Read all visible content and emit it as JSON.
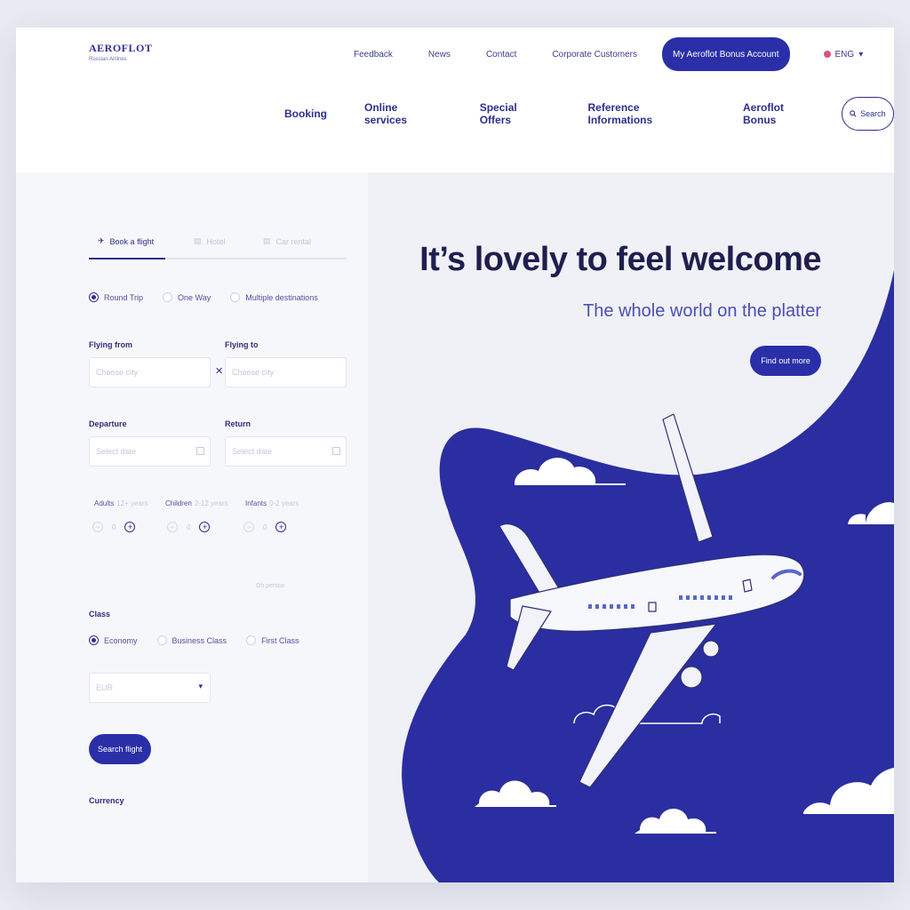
{
  "header": {
    "brand": "AEROFLOT",
    "tagline": "Russian Airlines",
    "top_links": [
      "Feedback",
      "News",
      "Contact",
      "Corporate Customers"
    ],
    "bonus_account": "My Aeroflot Bonus Account",
    "language": "ENG",
    "main_links": [
      "Booking",
      "Online services",
      "Special Offers",
      "Reference Informations",
      "Aeroflot Bonus"
    ],
    "search_label": "Search"
  },
  "booking": {
    "tabs": [
      "Book a flight",
      "Hotel",
      "Car rental"
    ],
    "trip_types": [
      "Round Trip",
      "One Way",
      "Multiple destinations"
    ],
    "from_label": "Flying from",
    "from_placeholder": "Choose city",
    "to_label": "Flying to",
    "to_placeholder": "Choose city",
    "departure_label": "Departure",
    "departure_placeholder": "Select date",
    "return_label": "Return",
    "return_placeholder": "Select date",
    "passengers": [
      {
        "label": "Adults",
        "sub": "12+ years",
        "value": "0"
      },
      {
        "label": "Children",
        "sub": "2-12 years",
        "value": "0"
      },
      {
        "label": "Infants",
        "sub": "0-2 years",
        "value": "0"
      }
    ],
    "passenger_hint": "Oh person",
    "class_label": "Class",
    "classes": [
      "Economy",
      "Business Class",
      "First Class"
    ],
    "currency_label": "Currency",
    "currency_value": "EUR",
    "submit_label": "Search flight"
  },
  "hero": {
    "title": "It’s lovely to feel welcome",
    "subtitle": "The whole world on the platter",
    "cta": "Find out more"
  },
  "colors": {
    "accent": "#2a2fa8",
    "dark_text": "#1e1f4f",
    "wave": "#2b2ea0"
  }
}
